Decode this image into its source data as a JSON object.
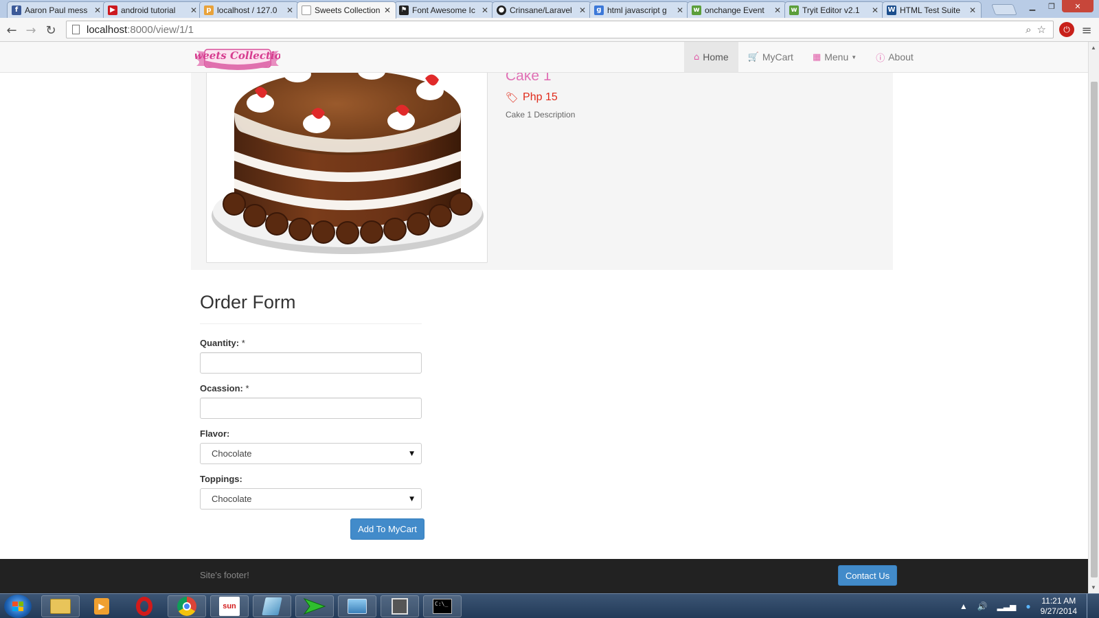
{
  "browser": {
    "tabs": [
      {
        "title": "Aaron Paul mess",
        "favicon": "facebook-favicon",
        "color": "#3b5998"
      },
      {
        "title": "android tutorial",
        "favicon": "youtube-favicon",
        "color": "#cc181e"
      },
      {
        "title": "localhost / 127.0",
        "favicon": "phpmyadmin-favicon",
        "color": "#e8a23a"
      },
      {
        "title": "Sweets Collection",
        "favicon": "page-favicon",
        "color": "#ffffff",
        "active": true
      },
      {
        "title": "Font Awesome Ic",
        "favicon": "flag-favicon",
        "color": "#222222"
      },
      {
        "title": "Crinsane/Laravel",
        "favicon": "github-favicon",
        "color": "#222222"
      },
      {
        "title": "html javascript g",
        "favicon": "google-favicon",
        "color": "#3c78d8"
      },
      {
        "title": "onchange Event",
        "favicon": "w3schools-favicon",
        "color": "#5b9e3a"
      },
      {
        "title": "Tryit Editor v2.1",
        "favicon": "w3schools-favicon",
        "color": "#5b9e3a"
      },
      {
        "title": "HTML Test Suite",
        "favicon": "w3c-favicon",
        "color": "#1a4d8c"
      }
    ],
    "url_host": "localhost",
    "url_path": ":8000/view/1/1"
  },
  "navbar": {
    "brand": "Sweets Collection",
    "links": [
      {
        "label": "Home",
        "icon": "home-icon",
        "active": true
      },
      {
        "label": "MyCart",
        "icon": "cart-icon"
      },
      {
        "label": "Menu",
        "icon": "grid-icon",
        "dropdown": true
      },
      {
        "label": "About",
        "icon": "info-icon"
      }
    ]
  },
  "product": {
    "title": "Cake 1",
    "price": "Php 15",
    "description": "Cake 1 Description",
    "image": "chocolate-cake-image"
  },
  "order_form": {
    "title": "Order Form",
    "quantity_label": "Quantity:",
    "occasion_label": "Ocassion:",
    "required_mark": "*",
    "quantity_value": "",
    "occasion_value": "",
    "flavor_label": "Flavor:",
    "flavor_value": "Chocolate",
    "toppings_label": "Toppings:",
    "toppings_value": "Chocolate",
    "submit_label": "Add To MyCart"
  },
  "footer": {
    "text": "Site's footer!",
    "contact_label": "Contact Us"
  },
  "taskbar": {
    "time": "11:21 AM",
    "date": "9/27/2014"
  },
  "colors": {
    "accent_pink": "#e070b5",
    "price_red": "#e02a1a",
    "primary_blue": "#428bca",
    "footer_bg": "#222222"
  }
}
